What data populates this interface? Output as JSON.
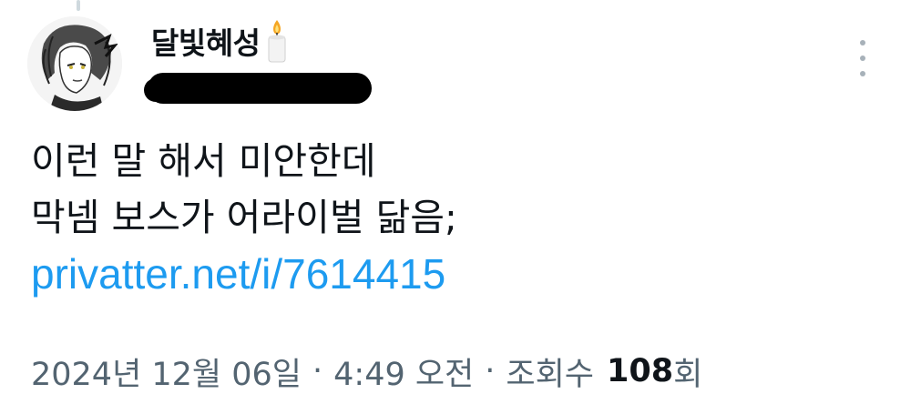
{
  "author": {
    "display_name": "달빛혜성",
    "name_emoji_icon": "candle-icon",
    "handle_redacted": true,
    "avatar_icon": "avatar-illustration"
  },
  "menu": {
    "more_icon": "vertical-ellipsis-icon"
  },
  "tweet": {
    "lines": [
      "이런 말 해서 미안한데",
      "막넴 보스가 어라이벌 닮음;"
    ],
    "link_text": "privatter.net/i/7614415"
  },
  "meta": {
    "date": "2024년 12월 06일",
    "separator": "·",
    "time": "4:49 오전",
    "views_label": "조회수",
    "views_count": "108",
    "views_suffix": "회"
  },
  "colors": {
    "text": "#0f1419",
    "secondary": "#536471",
    "link": "#1d9bf0"
  }
}
